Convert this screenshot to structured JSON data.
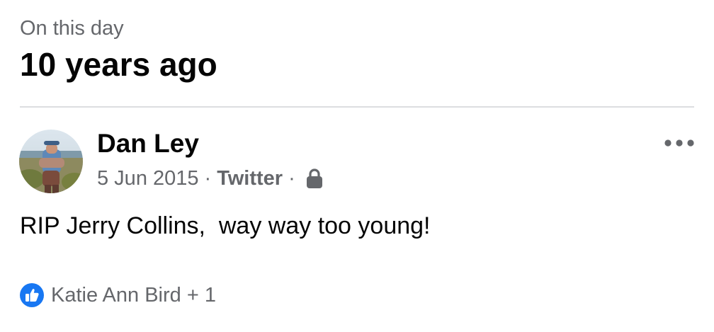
{
  "memory": {
    "subtitle": "On this day",
    "title": "10 years ago"
  },
  "post": {
    "author": "Dan Ley",
    "date": "5 Jun 2015",
    "source": "Twitter",
    "separator": "·",
    "privacy_icon": "lock-icon",
    "text": "RIP Jerry Collins,  way way too young!",
    "more_icon": "more-dots-icon"
  },
  "reactions": {
    "icon": "like-icon",
    "summary": "Katie Ann Bird + 1",
    "like_color": "#1877f2"
  },
  "colors": {
    "primary_text": "#050505",
    "secondary_text": "#65676b",
    "divider": "#dcdde0"
  }
}
